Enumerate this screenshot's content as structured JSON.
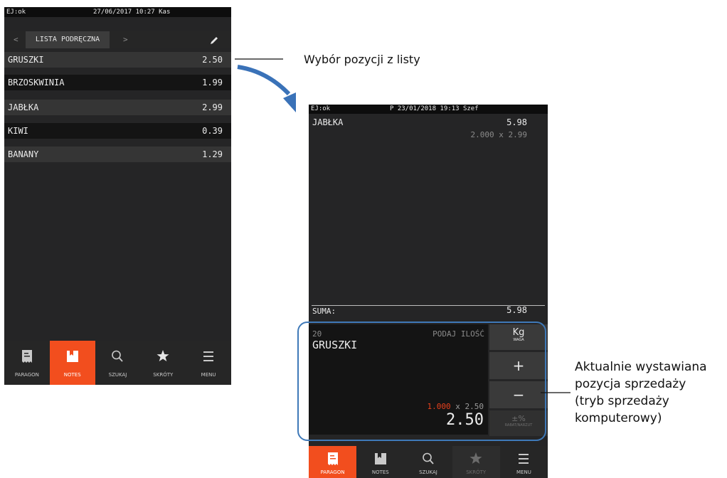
{
  "screen1": {
    "status": {
      "left": "EJ:ok",
      "center": "27/06/2017 10:27 Kas"
    },
    "tabs": {
      "prev": "<",
      "active": "LISTA PODRĘCZNA",
      "next": ">"
    },
    "items": [
      {
        "name": "GRUSZKI",
        "price": "2.50"
      },
      {
        "name": "BRZOSKWINIA",
        "price": "1.99"
      },
      {
        "name": "JABŁKA",
        "price": "2.99"
      },
      {
        "name": "KIWI",
        "price": "0.39"
      },
      {
        "name": "BANANY",
        "price": "1.29"
      }
    ],
    "nav": [
      "PARAGON",
      "NOTES",
      "SZUKAJ",
      "SKRÓTY",
      "MENU"
    ],
    "nav_active": "NOTES"
  },
  "screen2": {
    "status": {
      "left": "EJ:ok",
      "center": "P 23/01/2018 19:13 Szef"
    },
    "receipt_item": {
      "name": "JABŁKA",
      "total": "5.98",
      "qty_line": "2.000 x 2.99"
    },
    "sum_label": "SUMA:",
    "sum_value": "5.98",
    "entry": {
      "code": "20",
      "hint": "PODAJ ILOŚĆ",
      "name": "GRUSZKI",
      "qty": "1.000",
      "x_price": "x 2.50",
      "total": "2.50"
    },
    "side": {
      "unit": "Kg",
      "unit_sub": "WAGA",
      "plus": "+",
      "minus": "−",
      "discount": "±%",
      "discount_sub": "RABAT/NARZUT"
    },
    "nav": [
      "PARAGON",
      "NOTES",
      "SZUKAJ",
      "SKRÓTY",
      "MENU"
    ],
    "nav_active": "PARAGON"
  },
  "annotations": {
    "top": "Wybór pozycji z listy",
    "right_lines": [
      "Aktualnie wystawiana",
      "pozycja sprzedaży",
      "(tryb sprzedaży",
      "komputerowy)"
    ]
  },
  "colors": {
    "accent": "#f24e1e",
    "highlight_qty": "#e8401c",
    "callout_box": "#3f79b8",
    "arrow": "#3a72b8"
  }
}
